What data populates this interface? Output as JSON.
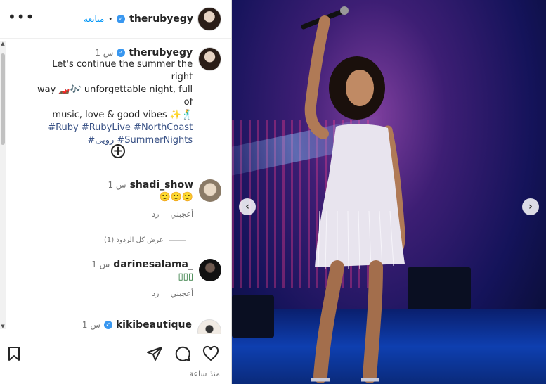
{
  "header": {
    "username": "therubyegy",
    "separator": "•",
    "follow_label": "متابعة",
    "more_label": "•••"
  },
  "caption": {
    "username": "therubyegy",
    "time": "1 س",
    "text_line1": "Let's continue the summer the right",
    "text_line2": "way 🏎️🎶 unforgettable night, full of",
    "text_line3": "music, love & good vibes ✨🕺",
    "tags_line1": "#Ruby #RubyLive #NorthCoast",
    "tags_line2": "#رويى #SummerNights"
  },
  "load_more_label": "+",
  "comments": [
    {
      "username": "shadi_show",
      "time": "1 س",
      "text": "🙂🙂🙂",
      "like_label": "أعجبني",
      "reply_label": "رد",
      "avatar_color": "#c9b9a6"
    },
    {
      "username": "darinesalama_",
      "time": "1 س",
      "text": "▯▯▯",
      "like_label": "أعجبني",
      "reply_label": "رد",
      "avatar_color": "#2b2b2b"
    },
    {
      "username": "kikibeautique",
      "time": "1 س",
      "text": "",
      "verified": true,
      "avatar_color": "#efe7df"
    }
  ],
  "view_replies_label": "عرض كل الردود (1)",
  "footer": {
    "since_label": "منذ ساعة",
    "icons": [
      "heart-icon",
      "comment-icon",
      "share-icon",
      "save-icon"
    ]
  },
  "photo": {
    "prev_label": "‹",
    "next_label": "›"
  },
  "colors": {
    "link_blue": "#0095f6",
    "hashtag": "#385185",
    "verified": "#3897f0"
  }
}
